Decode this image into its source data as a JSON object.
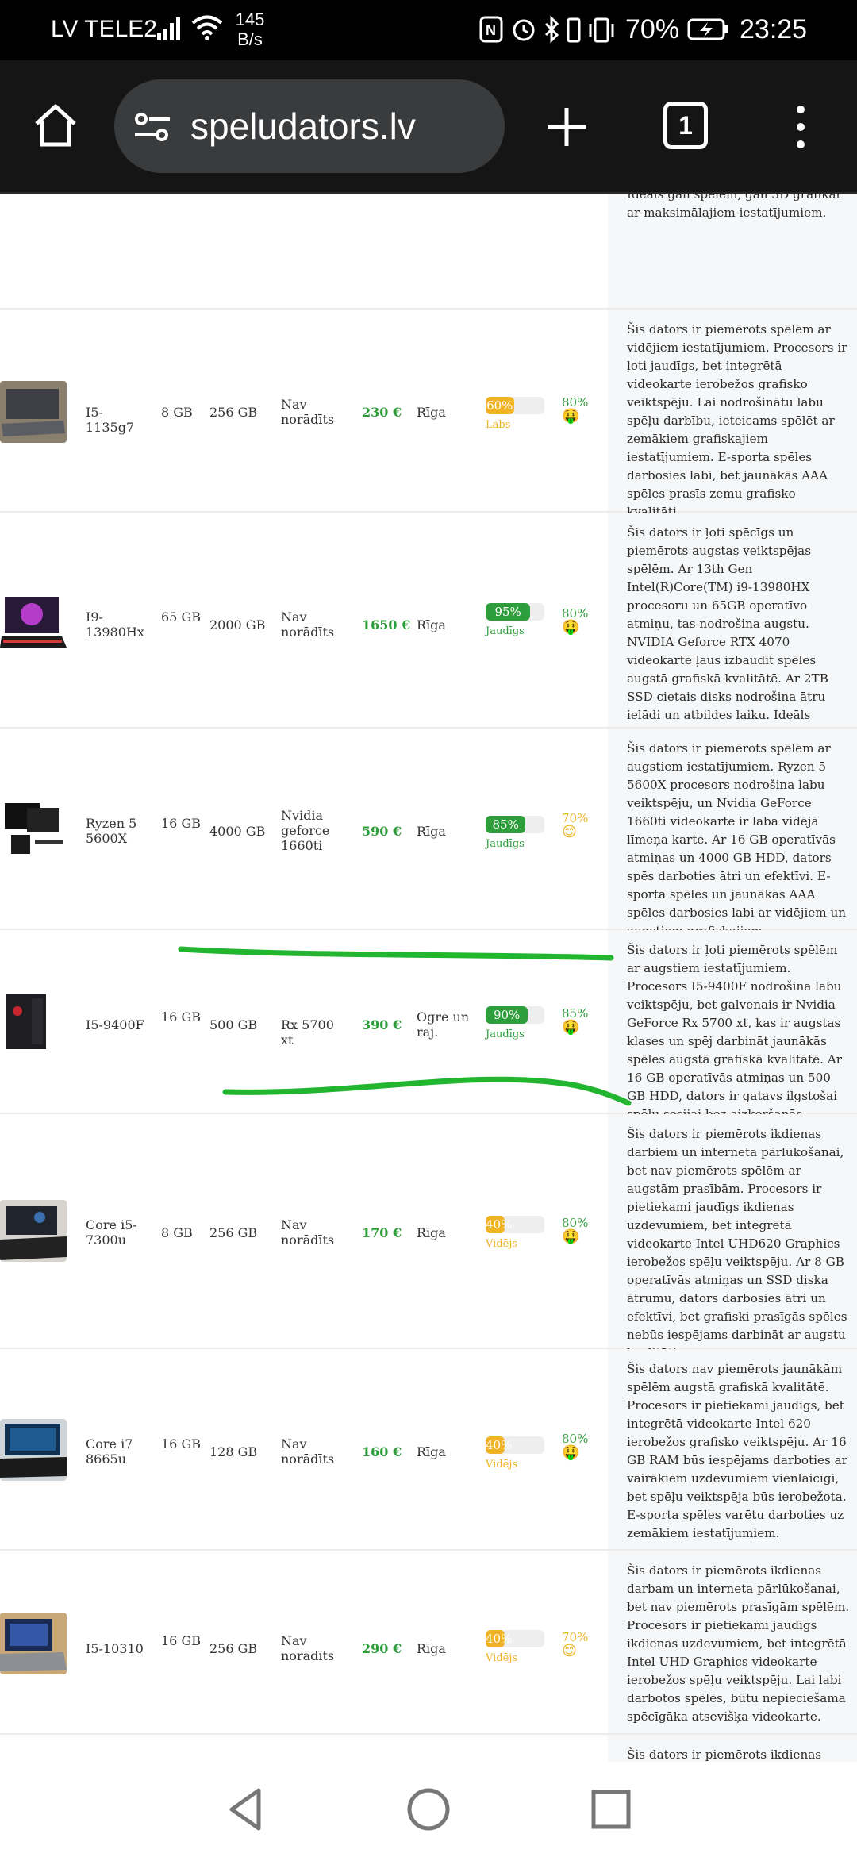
{
  "status_bar": {
    "carrier": "LV TELE2",
    "speed_value": "145",
    "speed_unit": "B/s",
    "battery_percent": "70%",
    "time": "23:25"
  },
  "browser": {
    "url": "speludators.lv",
    "tab_count": "1"
  },
  "listings": [
    {
      "cpu": "",
      "ram": "",
      "storage": "",
      "gpu": "",
      "price": "",
      "city": "",
      "performance_percent": null,
      "performance_label": "",
      "value_score": "",
      "value_emoji": "",
      "description": "grafisko veiktspēju. Ar Mini LED ROG Nebula HDR ekrānu un 240hz atsvaidzēšanas ātrumu, spēles izskatīsies un darbosies ļoti gludi. Ideāls gan spēlēm, gan 3D grafikai ar maksimālajiem iestatījumiem."
    },
    {
      "cpu": "I5-1135g7",
      "ram": "8 GB",
      "storage": "256 GB",
      "gpu": "Nav norādīts",
      "price": "230 €",
      "city": "Rīga",
      "performance_percent": 60,
      "performance_text": "60%",
      "performance_label": "Labs",
      "performance_color": "#f0b323",
      "value_score": "80%",
      "value_emoji": "🤑",
      "description": "Šis dators ir piemērots spēlēm ar vidējiem iestatījumiem. Procesors ir ļoti jaudīgs, bet integrētā videokarte ierobežos grafisko veiktspēju. Lai nodrošinātu labu spēļu darbību, ieteicams spēlēt ar zemākiem grafiskajiem iestatījumiem. E-sporta spēles darbosies labi, bet jaunākās AAA spēles prasīs zemu grafisko kvalitāti."
    },
    {
      "cpu": "I9-13980Hx",
      "ram": "65 GB",
      "storage": "2000 GB",
      "gpu": "Nav norādīts",
      "price": "1650 €",
      "city": "Rīga",
      "performance_percent": 95,
      "performance_text": "95%",
      "performance_label": "Jaudīgs",
      "performance_color": "#2e9d3c",
      "value_score": "80%",
      "value_emoji": "🤑",
      "description": "Šis dators ir ļoti spēcīgs un piemērots augstas veiktspējas spēlēm. Ar 13th Gen Intel(R)Core(TM) i9-13980HX procesoru un 65GB operatīvo atmiņu, tas nodrošina augstu. NVIDIA Geforce RTX 4070 videokarte ļaus izbaudīt spēles augstā grafiskā kvalitātē. Ar 2TB SSD cietais disks nodrošina ātru ielādi un atbildes laiku. Ideāls dators jaunākajām AAA spēlēm un VR spēlēm."
    },
    {
      "cpu": "Ryzen 5 5600X",
      "ram": "16 GB",
      "storage": "4000 GB",
      "gpu": "Nvidia geforce 1660ti",
      "price": "590 €",
      "city": "Rīga",
      "performance_percent": 85,
      "performance_text": "85%",
      "performance_label": "Jaudīgs",
      "performance_color": "#2e9d3c",
      "value_score": "70%",
      "value_emoji": "😊",
      "description": "Šis dators ir piemērots spēlēm ar augstiem iestatījumiem. Ryzen 5 5600X procesors nodrošina labu veiktspēju, un Nvidia GeForce 1660ti videokarte ir laba vidējā līmeņa karte. Ar 16 GB operatīvās atmiņas un 4000 GB HDD, dators spēs darboties ātri un efektīvi. E-sporta spēles un jaunākas AAA spēles darbosies labi ar vidējiem un augstiem grafiskajiem iestatījumiem."
    },
    {
      "cpu": "I5-9400F",
      "ram": "16 GB",
      "storage": "500 GB",
      "gpu": "Rx 5700 xt",
      "price": "390 €",
      "city": "Ogre un raj.",
      "performance_percent": 90,
      "performance_text": "90%",
      "performance_label": "Jaudīgs",
      "performance_color": "#2e9d3c",
      "value_score": "85%",
      "value_emoji": "🤑",
      "description": "Šis dators ir ļoti piemērots spēlēm ar augstiem iestatījumiem. Procesors I5-9400F nodrošina labu veiktspēju, bet galvenais ir Nvidia GeForce Rx 5700 xt, kas ir augstas klases un spēj darbināt jaunākās spēles augstā grafiskā kvalitātē. Ar 16 GB operatīvās atmiņas un 500 GB HDD, dators ir gatavs ilgstošai spēļu sesijai bez aizķeršanās."
    },
    {
      "cpu": "Core i5-7300u",
      "ram": "8 GB",
      "storage": "256 GB",
      "gpu": "Nav norādīts",
      "price": "170 €",
      "city": "Rīga",
      "performance_percent": 40,
      "performance_text": "40%",
      "performance_label": "Vidējs",
      "performance_color": "#f0b323",
      "value_score": "80%",
      "value_emoji": "🤑",
      "description": "Šis dators ir piemērots ikdienas darbiem un interneta pārlūkošanai, bet nav piemērots spēlēm ar augstām prasībām. Procesors ir pietiekami jaudīgs ikdienas uzdevumiem, bet integrētā videokarte Intel UHD620 Graphics ierobežos spēļu veiktspēju. Ar 8 GB operatīvās atmiņas un SSD diska ātrumu, dators darbosies ātri un efektīvi, bet grafiski prasīgās spēles nebūs iespējams darbināt ar augstu kvalitāti."
    },
    {
      "cpu": "Core i7 8665u",
      "ram": "16 GB",
      "storage": "128 GB",
      "gpu": "Nav norādīts",
      "price": "160 €",
      "city": "Rīga",
      "performance_percent": 40,
      "performance_text": "40%",
      "performance_label": "Vidējs",
      "performance_color": "#f0b323",
      "value_score": "80%",
      "value_emoji": "🤑",
      "description": "Šis dators nav piemērots jaunākām spēlēm augstā grafiskā kvalitātē. Procesors ir pietiekami jaudīgs, bet integrētā videokarte Intel 620 ierobežos grafisko veiktspēju. Ar 16 GB RAM būs iespējams darboties ar vairākiem uzdevumiem vienlaicīgi, bet spēļu veiktspēja būs ierobežota. E-sporta spēles varētu darboties uz zemākiem iestatījumiem."
    },
    {
      "cpu": "I5-10310",
      "ram": "16 GB",
      "storage": "256 GB",
      "gpu": "Nav norādīts",
      "price": "290 €",
      "city": "Rīga",
      "performance_percent": 40,
      "performance_text": "40%",
      "performance_label": "Vidējs",
      "performance_color": "#f0b323",
      "value_score": "70%",
      "value_emoji": "😊",
      "description": "Šis dators ir piemērots ikdienas darbam un interneta pārlūkošanai, bet nav piemērots prasīgām spēlēm. Procesors ir pietiekami jaudīgs ikdienas uzdevumiem, bet integrētā Intel UHD Graphics videokarte ierobežos spēļu veiktspēju. Lai labi darbotos spēlēs, būtu nepieciešama spēcīgāka atsevišķa videokarte."
    },
    {
      "cpu": "",
      "ram": "",
      "storage": "",
      "gpu": "",
      "price": "",
      "city": "",
      "performance_percent": null,
      "performance_label": "",
      "value_score": "",
      "value_emoji": "",
      "description": "Šis dators ir piemērots ikdienas"
    }
  ],
  "colors": {
    "price_green": "#2e9d3c",
    "perf_green": "#2e9d3c",
    "perf_yellow": "#f0b323",
    "annotation_green": "#22b52f"
  }
}
